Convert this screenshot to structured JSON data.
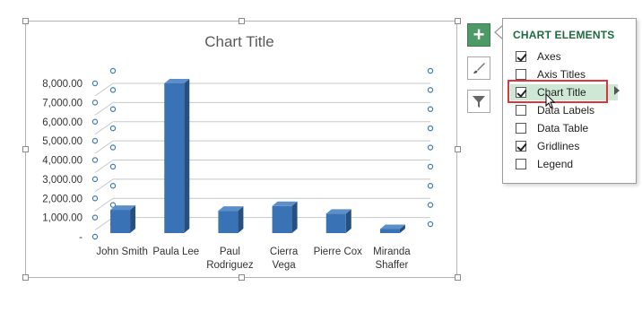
{
  "chart_data": {
    "type": "bar",
    "title": "Chart Title",
    "categories": [
      "John Smith",
      "Paula Lee",
      "Paul Rodriguez",
      "Cierra Vega",
      "Pierre Cox",
      "Miranda Shaffer"
    ],
    "category_lines": [
      [
        "John Smith"
      ],
      [
        "Paula Lee"
      ],
      [
        "Paul",
        "Rodriguez"
      ],
      [
        "Cierra",
        "Vega"
      ],
      [
        "Pierre Cox"
      ],
      [
        "Miranda",
        "Shaffer"
      ]
    ],
    "values": [
      1400,
      8000,
      1350,
      1600,
      1200,
      400
    ],
    "y_ticks": [
      0,
      1000,
      2000,
      3000,
      4000,
      5000,
      6000,
      7000,
      8000
    ],
    "y_tick_labels": [
      "-",
      "1,000.00",
      "2,000.00",
      "3,000.00",
      "4,000.00",
      "5,000.00",
      "6,000.00",
      "7,000.00",
      "8,000.00"
    ],
    "ylim": [
      0,
      8000
    ],
    "grid": true,
    "legend": "none",
    "colors": {
      "bar_front": "#3a73b5",
      "bar_side": "#274f80",
      "bar_top": "#5c8fc9",
      "grid": "#c8c8c8",
      "selection": "#3f7cb4"
    }
  },
  "panel": {
    "title": "CHART ELEMENTS",
    "options": [
      {
        "label": "Axes",
        "checked": true
      },
      {
        "label": "Axis Titles",
        "checked": false
      },
      {
        "label": "Chart Title",
        "checked": true
      },
      {
        "label": "Data Labels",
        "checked": false
      },
      {
        "label": "Data Table",
        "checked": false
      },
      {
        "label": "Gridlines",
        "checked": true
      },
      {
        "label": "Legend",
        "checked": false
      }
    ]
  },
  "side_buttons": [
    "plus-icon",
    "brush-icon",
    "filter-icon"
  ],
  "colors": {
    "accent_green": "#4e9a67",
    "panel_title": "#1d6b3f",
    "highlight_red": "#d9363e",
    "hover_row": "#cfe8d6"
  }
}
